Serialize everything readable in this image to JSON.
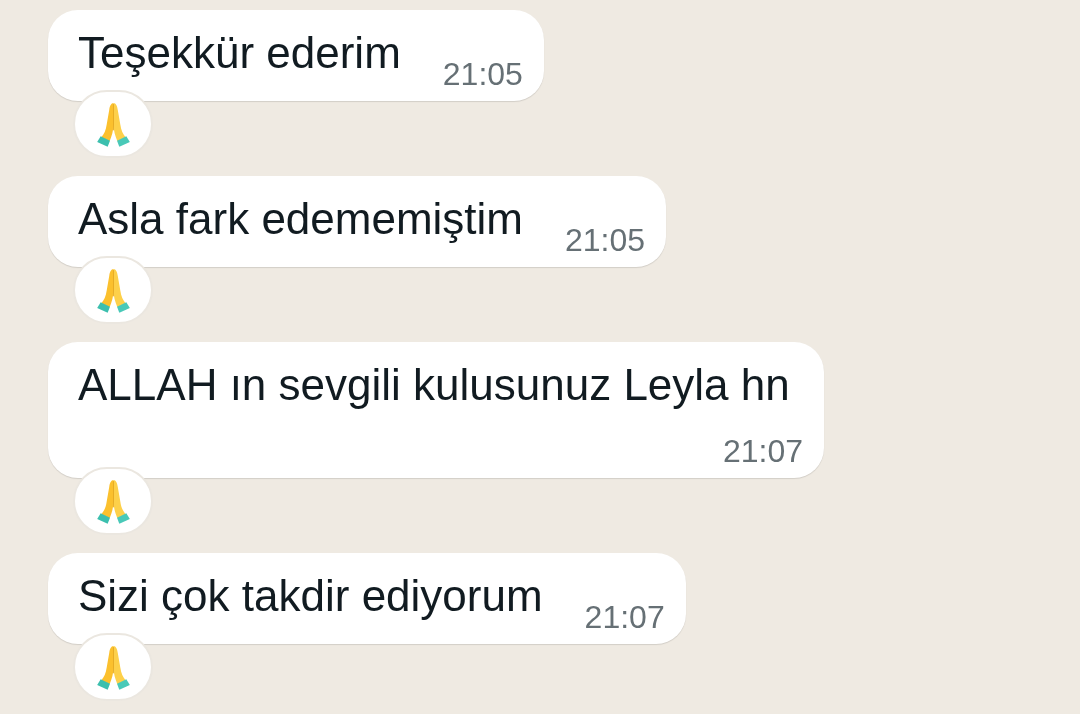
{
  "messages": [
    {
      "text": "Teşekkür ederim",
      "time": "21:05",
      "reacted": true
    },
    {
      "text": "Asla fark edememiştim",
      "time": "21:05",
      "reacted": true
    },
    {
      "text": "ALLAH ın sevgili kulusunuz Leyla hn",
      "time": "21:07",
      "reacted": true
    },
    {
      "text": "Sizi çok takdir ediyorum",
      "time": "21:07",
      "reacted": true
    }
  ]
}
